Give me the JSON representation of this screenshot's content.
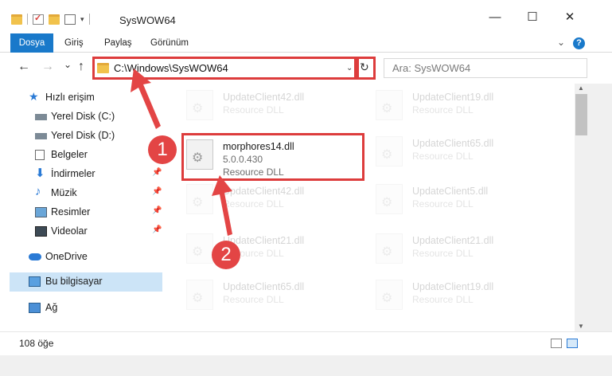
{
  "window": {
    "title": "SysWOW64",
    "minimize_glyph": "—",
    "maximize_glyph": "☐",
    "close_glyph": "✕"
  },
  "ribbon": {
    "tabs": [
      "Dosya",
      "Giriş",
      "Paylaş",
      "Görünüm"
    ],
    "expand_glyph": "⌄",
    "help_glyph": "?"
  },
  "nav_buttons": {
    "back": "←",
    "forward": "→",
    "recent": "⌄",
    "up": "↑"
  },
  "address": {
    "path": "C:\\Windows\\SysWOW64",
    "dropdown_glyph": "⌄",
    "refresh_glyph": "↻"
  },
  "search": {
    "placeholder": "Ara: SysWOW64"
  },
  "nav_pane": {
    "items": [
      {
        "label": "Hızlı erişim",
        "icon": "star-icon"
      },
      {
        "label": "Yerel Disk (C:)",
        "icon": "drive-icon"
      },
      {
        "label": "Yerel Disk (D:)",
        "icon": "drive-icon"
      },
      {
        "label": "Belgeler",
        "icon": "document-icon"
      },
      {
        "label": "İndirmeler",
        "icon": "download-icon"
      },
      {
        "label": "Müzik",
        "icon": "music-icon"
      },
      {
        "label": "Resimler",
        "icon": "picture-icon"
      },
      {
        "label": "Videolar",
        "icon": "video-icon"
      },
      {
        "label": "OneDrive",
        "icon": "cloud-icon"
      },
      {
        "label": "Bu bilgisayar",
        "icon": "computer-icon"
      },
      {
        "label": "Ağ",
        "icon": "network-icon"
      }
    ],
    "pin_glyph": "📌"
  },
  "files": {
    "left": [
      {
        "name": "UpdateClient42.dll",
        "type": "Resource DLL"
      },
      {
        "name": "morphores14.dll",
        "version": "5.0.0.430",
        "type": "Resource DLL"
      },
      {
        "name": "UpdateClient42.dll",
        "type": "Resource DLL"
      },
      {
        "name": "UpdateClient21.dll",
        "type": "Resource DLL"
      },
      {
        "name": "UpdateClient65.dll",
        "type": "Resource DLL"
      }
    ],
    "right": [
      {
        "name": "UpdateClient19.dll",
        "type": "Resource DLL"
      },
      {
        "name": "UpdateClient65.dll",
        "type": "Resource DLL"
      },
      {
        "name": "UpdateClient5.dll",
        "type": "Resource DLL"
      },
      {
        "name": "UpdateClient21.dll",
        "type": "Resource DLL"
      },
      {
        "name": "UpdateClient19.dll",
        "type": "Resource DLL"
      }
    ]
  },
  "status": {
    "item_count": "108 öğe"
  },
  "annotations": {
    "step1": "1",
    "step2": "2"
  },
  "colors": {
    "highlight": "#dd3c3c",
    "accent": "#1979ca",
    "callout": "#e34545"
  }
}
